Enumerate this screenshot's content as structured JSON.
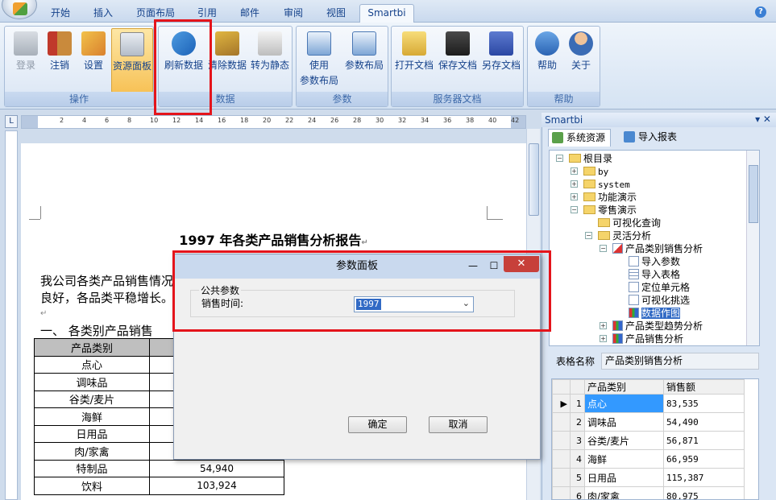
{
  "ribbon": {
    "tabs": [
      "开始",
      "插入",
      "页面布局",
      "引用",
      "邮件",
      "审阅",
      "视图",
      "Smartbi"
    ],
    "active_tab": "Smartbi",
    "help": "?",
    "groups": {
      "ops": {
        "title": "操作",
        "buttons": [
          "登录",
          "注销",
          "设置",
          "资源面板"
        ]
      },
      "data": {
        "title": "数据",
        "buttons": [
          "刷新数据",
          "清除数据",
          "转为静态"
        ]
      },
      "params": {
        "title": "参数",
        "buttons": [
          "使用参数布局",
          "参数布局"
        ],
        "btn1_line1": "使用",
        "btn1_line2": "参数布局"
      },
      "server": {
        "title": "服务器文档",
        "buttons": [
          "打开文档",
          "保存文档",
          "另存文档"
        ]
      },
      "help": {
        "title": "帮助",
        "buttons": [
          "帮助",
          "关于"
        ]
      }
    }
  },
  "ruler": {
    "corner": "L",
    "ticks": [
      "2",
      "4",
      "6",
      "8",
      "10",
      "12",
      "14",
      "16",
      "18",
      "20",
      "22",
      "24",
      "26",
      "28",
      "30",
      "32",
      "34",
      "36",
      "38",
      "40",
      "42"
    ]
  },
  "document": {
    "title": "1997  年各类产品销售分析报告",
    "para1": "我公司各类产品销售情况",
    "para2": "良好，各品类平稳增长。",
    "section": "一、    各类别产品销售",
    "table": {
      "header": [
        "产品类别",
        ""
      ],
      "rows": [
        [
          "点心",
          ""
        ],
        [
          "调味品",
          ""
        ],
        [
          "谷类/麦片",
          ""
        ],
        [
          "海鲜",
          ""
        ],
        [
          "日用品",
          ""
        ],
        [
          "肉/家禽",
          ""
        ],
        [
          "特制品",
          "54,940"
        ],
        [
          "饮料",
          "103,924"
        ]
      ]
    }
  },
  "panel": {
    "title": "Smartbi",
    "controls": "▾ ✕",
    "tabs": [
      "系统资源",
      "导入报表"
    ],
    "tree": {
      "root": "根目录",
      "by": "by",
      "system": "system",
      "demo": "功能演示",
      "retail": "零售演示",
      "visual_query": "可视化查询",
      "flex": "灵活分析",
      "cat_sales": "产品类别销售分析",
      "import_params": "导入参数",
      "import_table": "导入表格",
      "locate_cell": "定位单元格",
      "visual_pick": "可视化挑选",
      "data_chart": "数据作图",
      "cat_trend": "产品类型趋势分析",
      "product_sales": "产品销售分析"
    },
    "table_name_label": "表格名称",
    "table_name_value": "产品类别销售分析",
    "grid": {
      "headers": [
        "产品类别",
        "销售额"
      ],
      "rows": [
        [
          "1",
          "点心",
          "83,535"
        ],
        [
          "2",
          "调味品",
          "54,490"
        ],
        [
          "3",
          "谷类/麦片",
          "56,871"
        ],
        [
          "4",
          "海鲜",
          "66,959"
        ],
        [
          "5",
          "日用品",
          "115,387"
        ],
        [
          "6",
          "肉/家禽",
          "80,975"
        ]
      ]
    }
  },
  "dialog": {
    "title": "参数面板",
    "group_label": "公共参数",
    "field_label": "销售时间:",
    "field_value": "1997",
    "ok": "确定",
    "cancel": "取消",
    "minimize": "—",
    "maximize": "☐",
    "close": "✕"
  },
  "colors": {
    "highlight_box": "#e4141b",
    "selection": "#316ac5",
    "grid_highlight": "#3399ff"
  }
}
